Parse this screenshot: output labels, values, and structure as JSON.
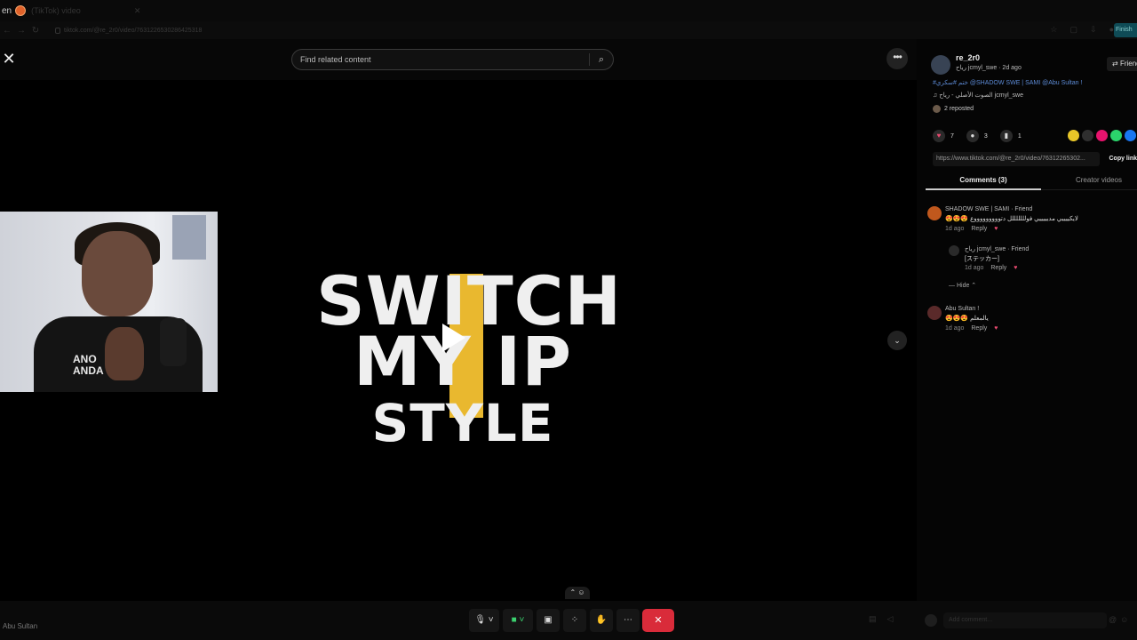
{
  "browser": {
    "tab_prefix": "en",
    "tab_title": "(TikTok) video",
    "url": "tiktok.com/@re_2r0/video/7631226530286425318",
    "finish_label": "Finish"
  },
  "viewer": {
    "search_placeholder": "Find related content",
    "more_label": "•••",
    "close_label": "✕",
    "logo": {
      "line1": "SWITCH",
      "line2": "MY IP",
      "line3": "STYLE"
    },
    "down_label": "⌄"
  },
  "webcam": {
    "shirt_text_1": "ANO",
    "shirt_text_2": "ANDA"
  },
  "post": {
    "author": "re_2r0",
    "author_sub": "رياح jcmyl_swe · 2d ago",
    "friends_label": "Friends",
    "caption": "#ختم #سكري @SHADOW SWE | SAMI @Abu Sultan !",
    "sound": "♫ الصوت الأصلي - رياح jcmyl_swe",
    "reposted": "2 reposted",
    "likes": "7",
    "comments": "3",
    "saves": "1",
    "link": "https://www.tiktok.com/@re_2r0/video/76312265302...",
    "copy_label": "Copy link",
    "share_colors": [
      "#e8c628",
      "#2f2f2f",
      "#e8136d",
      "#2bd36b",
      "#1877f2"
    ]
  },
  "tabs": {
    "comments": "Comments (3)",
    "creator": "Creator videos"
  },
  "comments": [
    {
      "name": "SHADOW SWE | SAMI · Friend",
      "text": "😍😍😍 لايكييييي مديييييي فولللللللل دتوووووووووع",
      "time": "1d ago",
      "reply": "Reply",
      "avatar": "#c0581d"
    },
    {
      "name": "رياح jcmyl_swe · Friend",
      "text": "[ステッカー]",
      "time": "1d ago",
      "reply": "Reply",
      "avatar": "#2a2a2a"
    },
    {
      "name": "Abu Sultan !",
      "text": "😍😍😍 يالمعلم",
      "time": "1d ago",
      "reply": "Reply",
      "avatar": "#5a2a2a"
    }
  ],
  "hide_label": "Hide ⌃",
  "bottom": {
    "user": "Abu Sultan",
    "caret": "⌃",
    "comment_placeholder": "Add comment..."
  }
}
